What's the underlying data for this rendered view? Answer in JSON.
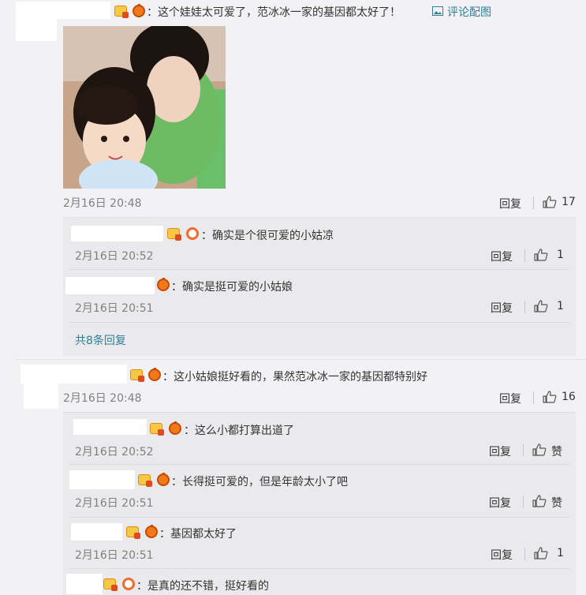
{
  "comments": [
    {
      "text": "：这个娃娃太可爱了，范冰冰一家的基因都太好了！",
      "pic_link": "评论配图",
      "time": "2月16日 20:48",
      "reply_label": "回复",
      "likes": "17",
      "replies": [
        {
          "text": "：确实是个很可爱的小姑凉",
          "time": "2月16日 20:52",
          "reply_label": "回复",
          "likes": "1"
        },
        {
          "text": "：确实是挺可爱的小姑娘",
          "time": "2月16日 20:51",
          "reply_label": "回复",
          "likes": "1"
        }
      ],
      "more_replies": "共8条回复"
    },
    {
      "text": "：这小姑娘挺好看的，果然范冰冰一家的基因都特别好",
      "time": "2月16日 20:48",
      "reply_label": "回复",
      "likes": "16",
      "replies": [
        {
          "text": "：这么小都打算出道了",
          "time": "2月16日 20:52",
          "reply_label": "回复",
          "likes": "赞"
        },
        {
          "text": "：长得挺可爱的，但是年龄太小了吧",
          "time": "2月16日 20:51",
          "reply_label": "回复",
          "likes": "赞"
        },
        {
          "text": "：基因都太好了",
          "time": "2月16日 20:51",
          "reply_label": "回复",
          "likes": "1"
        },
        {
          "text": "：是真的还不错，挺好看的"
        }
      ]
    }
  ],
  "colors": {
    "background": "#f2f2f5",
    "reply_bg": "#eaeaec",
    "link": "#2f7e99",
    "meta": "#808080"
  },
  "icons": {
    "image": "image-icon",
    "like": "thumbs-up-icon",
    "vip": "vip-badge-icon",
    "lantern": "lantern-icon"
  }
}
